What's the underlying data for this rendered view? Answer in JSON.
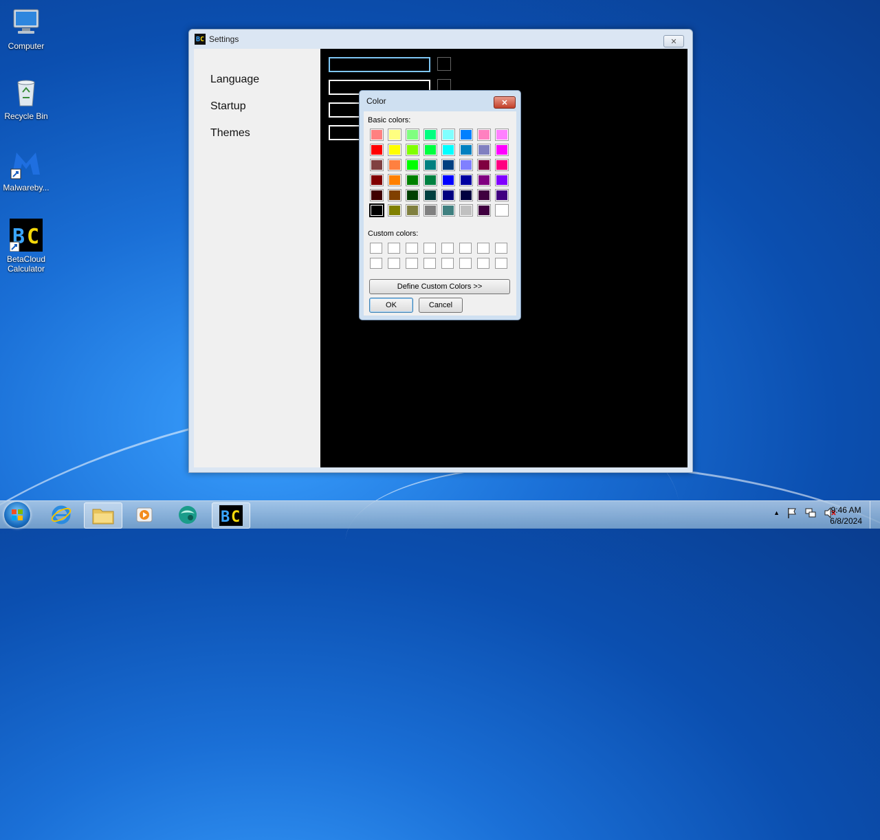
{
  "desktop": {
    "icons": [
      {
        "label": "Computer"
      },
      {
        "label": "Recycle Bin"
      },
      {
        "label": "Malwareby..."
      },
      {
        "label": "BetaCloud Calculator"
      }
    ]
  },
  "settings_window": {
    "title": "Settings",
    "logo_text": {
      "b": "B",
      "c": "C"
    },
    "close_glyph": "✕",
    "sidebar": [
      "Language",
      "Startup",
      "Themes"
    ]
  },
  "color_dialog": {
    "title": "Color",
    "close_glyph": "✕",
    "basic_label": "Basic colors:",
    "custom_label": "Custom colors:",
    "define_button": "Define Custom Colors >>",
    "ok_button": "OK",
    "cancel_button": "Cancel",
    "selected_index": 40,
    "basic_colors": [
      "#ff8080",
      "#ffff80",
      "#80ff80",
      "#00ff80",
      "#80ffff",
      "#0080ff",
      "#ff80c0",
      "#ff80ff",
      "#ff0000",
      "#ffff00",
      "#80ff00",
      "#00ff40",
      "#00ffff",
      "#0080c0",
      "#8080c0",
      "#ff00ff",
      "#804040",
      "#ff8040",
      "#00ff00",
      "#008080",
      "#004080",
      "#8080ff",
      "#800040",
      "#ff0080",
      "#800000",
      "#ff8000",
      "#008000",
      "#008040",
      "#0000ff",
      "#0000a0",
      "#800080",
      "#8000ff",
      "#400000",
      "#804000",
      "#004000",
      "#004040",
      "#000080",
      "#000040",
      "#400040",
      "#400080",
      "#000000",
      "#808000",
      "#808040",
      "#808080",
      "#408080",
      "#c0c0c0",
      "#400040",
      "#ffffff"
    ]
  },
  "taskbar": {
    "time": "9:46 AM",
    "date": "6/8/2024",
    "tray_arrow": "▲"
  }
}
